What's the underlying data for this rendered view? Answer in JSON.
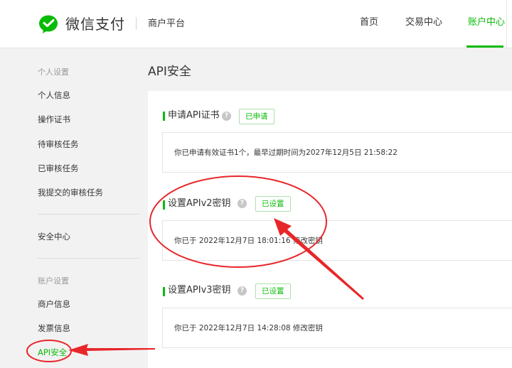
{
  "header": {
    "brand": "微信支付",
    "platform": "商户平台",
    "nav": [
      {
        "label": "首页",
        "active": false
      },
      {
        "label": "交易中心",
        "active": false
      },
      {
        "label": "账户中心",
        "active": true
      }
    ]
  },
  "sidebar": {
    "group_personal": "个人设置",
    "personal_items": [
      "个人信息",
      "操作证书",
      "待审核任务",
      "已审核任务",
      "我提交的审核任务"
    ],
    "security_center": "安全中心",
    "group_account": "账户设置",
    "account_items": [
      "商户信息",
      "发票信息",
      "API安全"
    ]
  },
  "main": {
    "title": "API安全",
    "sections": [
      {
        "title": "申请API证书",
        "help": "?",
        "tag": "已申请",
        "info": "你已申请有效证书1个，最早过期时间为2027年12月5日 21:58:22"
      },
      {
        "title": "设置APIv2密钥",
        "help": "?",
        "tag": "已设置",
        "info": "你已于 2022年12月7日 18:01:16 修改密钥"
      },
      {
        "title": "设置APIv3密钥",
        "help": "?",
        "tag": "已设置",
        "info": "你已于 2022年12月7日 14:28:08 修改密钥"
      }
    ]
  },
  "colors": {
    "accent": "#09bb07",
    "annotation": "#e8262a"
  }
}
